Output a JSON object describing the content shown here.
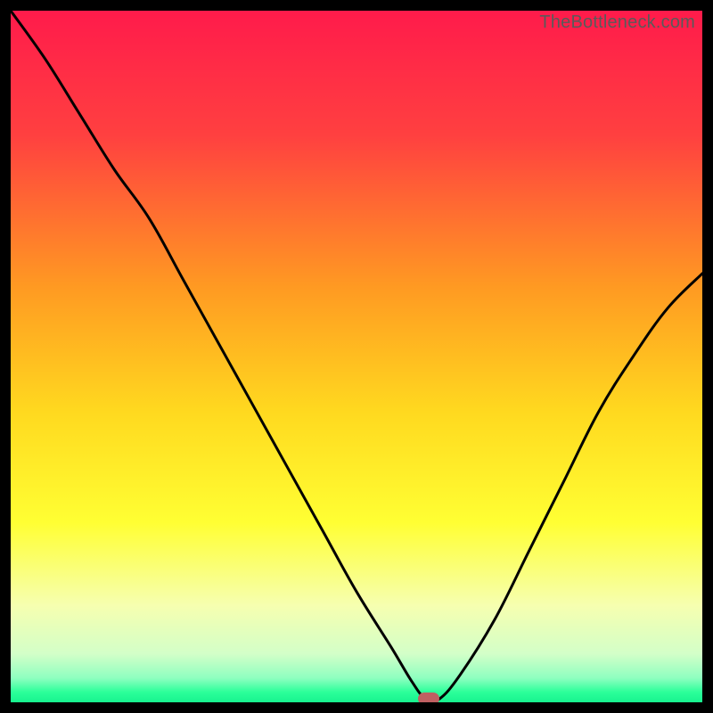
{
  "watermark": "TheBottleneck.com",
  "colors": {
    "frame": "#000000",
    "curve": "#000000",
    "marker": "#c06062",
    "gradient_stops": [
      {
        "pct": 0,
        "color": "#ff1b4b"
      },
      {
        "pct": 18,
        "color": "#ff4040"
      },
      {
        "pct": 40,
        "color": "#ff9a22"
      },
      {
        "pct": 58,
        "color": "#ffd91f"
      },
      {
        "pct": 74,
        "color": "#ffff33"
      },
      {
        "pct": 86,
        "color": "#f6ffb0"
      },
      {
        "pct": 93,
        "color": "#d3ffc8"
      },
      {
        "pct": 96.5,
        "color": "#8effc0"
      },
      {
        "pct": 98.5,
        "color": "#2cff9a"
      },
      {
        "pct": 100,
        "color": "#17f38f"
      }
    ]
  },
  "chart_data": {
    "type": "line",
    "title": "",
    "xlabel": "",
    "ylabel": "",
    "xlim": [
      0,
      100
    ],
    "ylim": [
      0,
      100
    ],
    "series": [
      {
        "name": "bottleneck-curve",
        "x": [
          0,
          5,
          10,
          15,
          20,
          25,
          30,
          35,
          40,
          45,
          50,
          55,
          58,
          60,
          62,
          65,
          70,
          75,
          80,
          85,
          90,
          95,
          100
        ],
        "y": [
          100,
          93,
          85,
          77,
          70,
          61,
          52,
          43,
          34,
          25,
          16,
          8,
          3,
          0.5,
          0.5,
          4,
          12,
          22,
          32,
          42,
          50,
          57,
          62
        ]
      }
    ],
    "marker": {
      "x": 60.5,
      "y": 0.5
    }
  }
}
